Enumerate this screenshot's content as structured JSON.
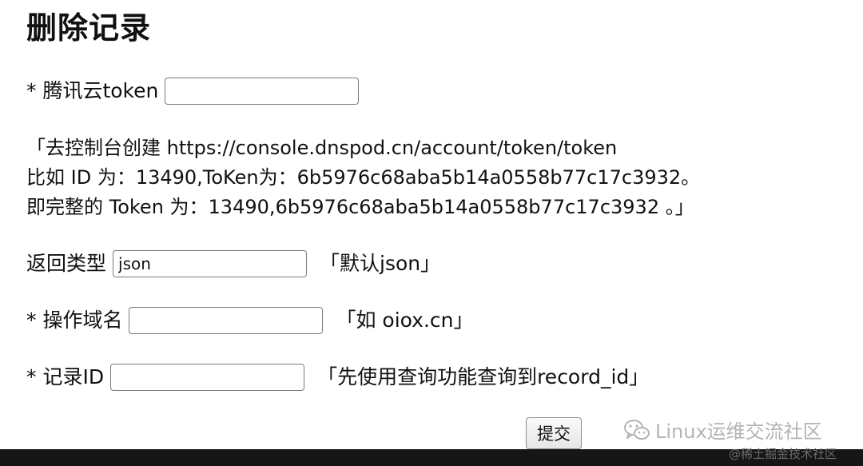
{
  "form": {
    "title": "删除记录",
    "token": {
      "label": "* 腾讯云token",
      "value": ""
    },
    "note_lines": [
      "「去控制台创建 https://console.dnspod.cn/account/token/token",
      "比如 ID 为：13490,ToKen为：6b5976c68aba5b14a0558b77c17c3932。",
      "即完整的 Token 为：13490,6b5976c68aba5b14a0558b77c17c3932 。」"
    ],
    "return_type": {
      "label": "返回类型",
      "value": "json",
      "hint": "「默认json」"
    },
    "domain": {
      "label": "* 操作域名",
      "value": "",
      "hint": "「如 oiox.cn」"
    },
    "record_id": {
      "label": "* 记录ID",
      "value": "",
      "hint": "「先使用查询功能查询到record_id」"
    },
    "submit_label": "提交"
  },
  "watermark": {
    "text": "Linux运维交流社区",
    "subtext": "@稀土掘金技术社区",
    "icon": "wechat-icon"
  }
}
